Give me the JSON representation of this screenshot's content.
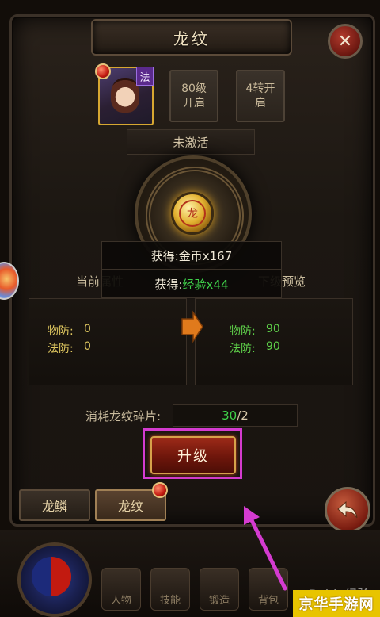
{
  "title": "龙纹",
  "hero": {
    "class_tag": "法"
  },
  "slots": [
    {
      "label": "80级\n开启"
    },
    {
      "label": "4转开\n启"
    }
  ],
  "status": "未激活",
  "toasts": [
    {
      "prefix": "获得:",
      "value": "金币x167",
      "value_color": "#f1ead8"
    },
    {
      "prefix": "获得:",
      "value": "经验x44",
      "value_color": "#3fd24a"
    }
  ],
  "compare": {
    "current_header": "当前属性",
    "next_header": "下级预览",
    "current": [
      {
        "label": "物防:",
        "value": "0"
      },
      {
        "label": "法防:",
        "value": "0"
      }
    ],
    "next": [
      {
        "label": "物防:",
        "value": "90"
      },
      {
        "label": "法防:",
        "value": "90"
      }
    ]
  },
  "cost": {
    "label": "消耗龙纹碎片:",
    "have": "30",
    "need": "/2"
  },
  "upgrade_label": "升级",
  "tabs": [
    {
      "label": "龙鳞"
    },
    {
      "label": "龙纹"
    }
  ],
  "bottom_menu": [
    {
      "label": "人物"
    },
    {
      "label": "技能"
    },
    {
      "label": "锻造"
    },
    {
      "label": "背包"
    }
  ],
  "watermark": {
    "text": "Baidu经验",
    "logo": "京华手游网"
  },
  "colors": {
    "accent_gold": "#d6a731",
    "highlight": "#d43bd0",
    "gain_green": "#3fd24a",
    "stat_yellow": "#e0c860",
    "next_green": "#5fd24a"
  },
  "icons": [
    "close-icon",
    "back-arrow-icon",
    "coin-icon",
    "right-arrow-icon",
    "red-notice-dot"
  ]
}
